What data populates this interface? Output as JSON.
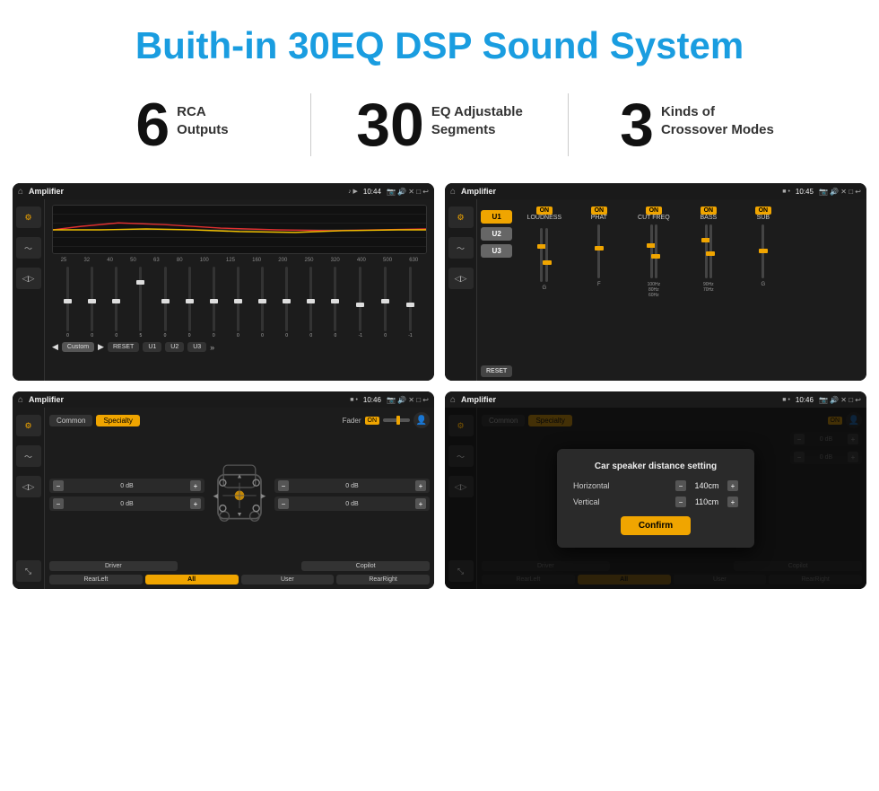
{
  "header": {
    "title": "Buith-in 30EQ DSP Sound System"
  },
  "stats": [
    {
      "number": "6",
      "label": "RCA\nOutputs"
    },
    {
      "number": "30",
      "label": "EQ Adjustable\nSegments"
    },
    {
      "number": "3",
      "label": "Kinds of\nCrossover Modes"
    }
  ],
  "screen1": {
    "title": "Amplifier",
    "time": "10:44",
    "type": "equalizer",
    "frequencies": [
      "25",
      "32",
      "40",
      "50",
      "63",
      "80",
      "100",
      "125",
      "160",
      "200",
      "250",
      "320",
      "400",
      "500",
      "630"
    ],
    "values": [
      "0",
      "0",
      "0",
      "5",
      "0",
      "0",
      "0",
      "0",
      "0",
      "0",
      "0",
      "0",
      "-1",
      "0",
      "-1"
    ],
    "preset": "Custom",
    "buttons": [
      "RESET",
      "U1",
      "U2",
      "U3"
    ]
  },
  "screen2": {
    "title": "Amplifier",
    "time": "10:45",
    "type": "crossover",
    "uButtons": [
      "U1",
      "U2",
      "U3"
    ],
    "controls": [
      {
        "name": "LOUDNESS",
        "on": true
      },
      {
        "name": "PHAT",
        "on": true
      },
      {
        "name": "CUT FREQ",
        "on": true
      },
      {
        "name": "BASS",
        "on": true
      },
      {
        "name": "SUB",
        "on": true
      }
    ]
  },
  "screen3": {
    "title": "Amplifier",
    "time": "10:46",
    "type": "specialty",
    "tabs": [
      "Common",
      "Specialty"
    ],
    "activeTab": "Specialty",
    "fader": "Fader",
    "faderOn": "ON",
    "dbValues": [
      "0 dB",
      "0 dB",
      "0 dB",
      "0 dB"
    ],
    "bottomButtons": [
      "Driver",
      "",
      "Copilot",
      "RearLeft",
      "All",
      "User",
      "RearRight"
    ]
  },
  "screen4": {
    "title": "Amplifier",
    "time": "10:46",
    "type": "specialty-dialog",
    "tabs": [
      "Common",
      "Specialty"
    ],
    "activeTab": "Specialty",
    "dialog": {
      "title": "Car speaker distance setting",
      "fields": [
        {
          "label": "Horizontal",
          "value": "140cm"
        },
        {
          "label": "Vertical",
          "value": "110cm"
        }
      ],
      "confirmLabel": "Confirm"
    },
    "dbValues": [
      "0 dB",
      "0 dB"
    ],
    "bottomButtons": [
      "Driver",
      "Copilot",
      "RearLeft",
      "All",
      "User",
      "RearRight"
    ]
  }
}
